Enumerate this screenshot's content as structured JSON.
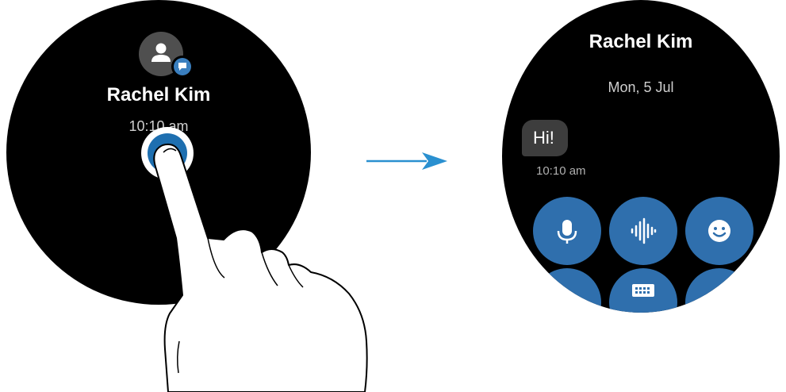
{
  "left_watch": {
    "contact_name": "Rachel Kim",
    "time": "10:10 am",
    "avatar_icon": "person-icon",
    "badge_icon": "message-icon"
  },
  "right_watch": {
    "contact_name": "Rachel Kim",
    "date": "Mon, 5 Jul",
    "message_text": "Hi!",
    "message_time": "10:10 am",
    "buttons": [
      {
        "icon": "microphone-icon"
      },
      {
        "icon": "audio-waveform-icon"
      },
      {
        "icon": "emoji-icon"
      },
      {
        "icon": "keyboard-icon"
      }
    ]
  },
  "colors": {
    "button_blue": "#2f6fad",
    "touch_blue": "#1e6fb0",
    "arrow_blue": "#2a90d0",
    "bubble_gray": "#3d3d3d"
  }
}
